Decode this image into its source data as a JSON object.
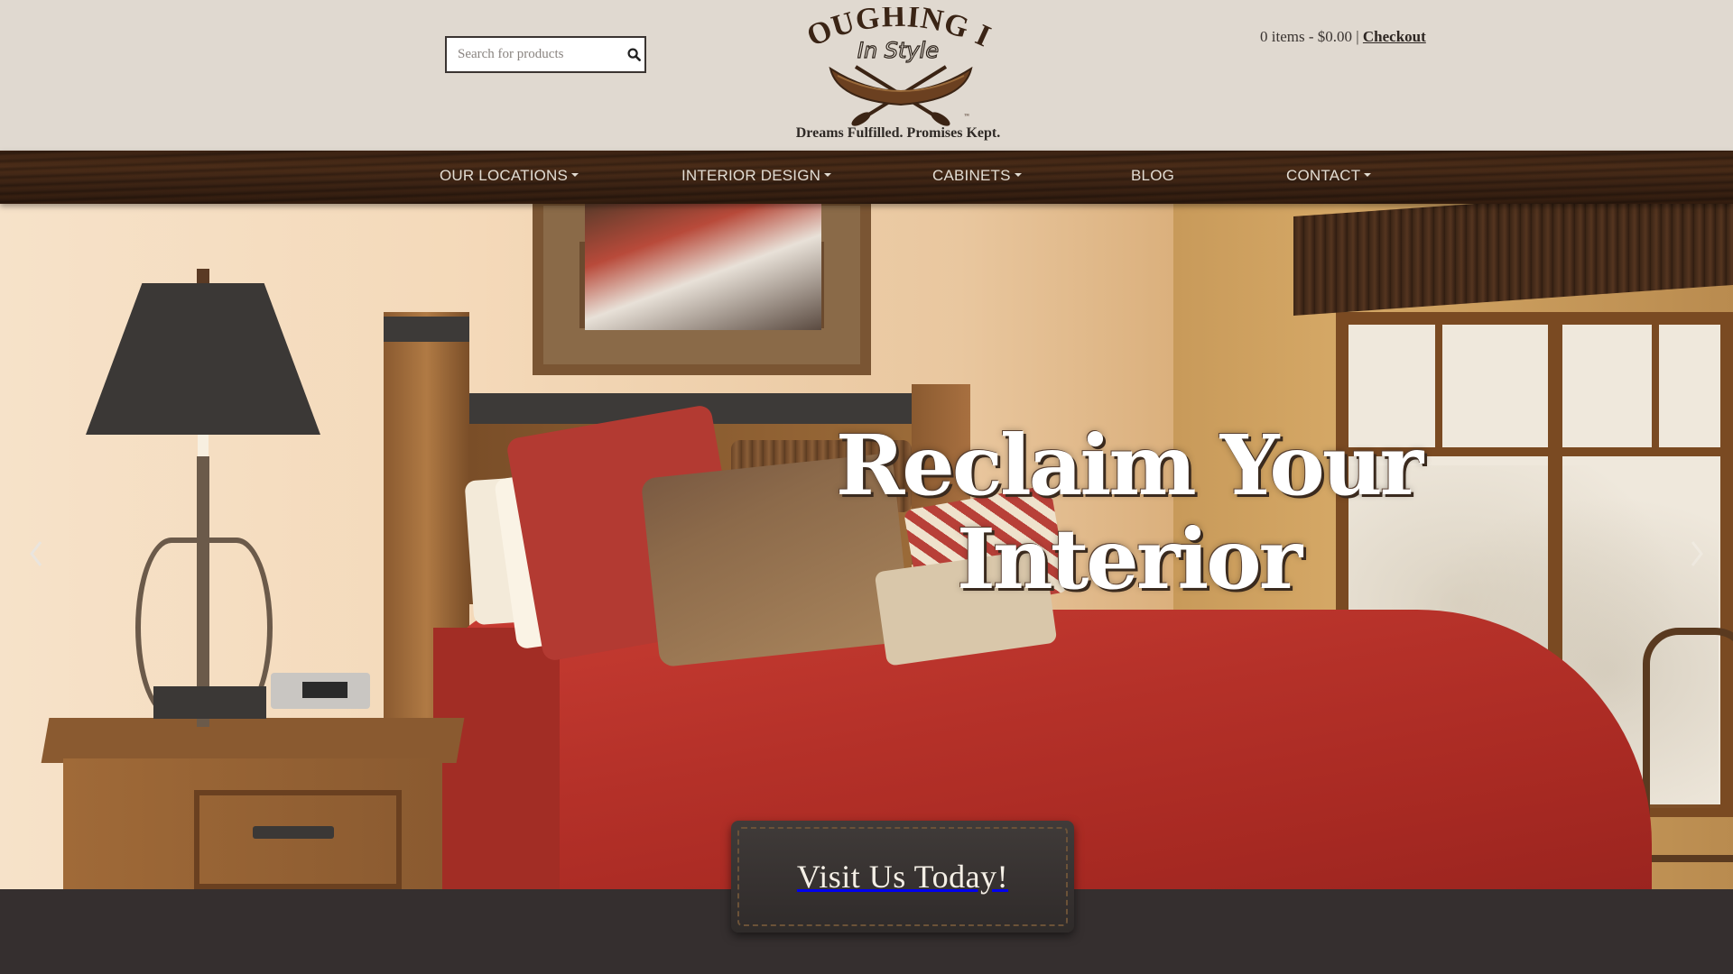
{
  "header": {
    "search": {
      "placeholder": "Search for products",
      "value": "",
      "button_icon": "search-icon"
    },
    "logo": {
      "line1": "ROUGHING IT",
      "line2": "In Style",
      "trademark": "™",
      "tagline": "Dreams Fulfilled. Promises Kept."
    },
    "cart": {
      "summary": "0 items - $0.00",
      "separator": "|",
      "checkout_label": "Checkout"
    }
  },
  "nav": {
    "items": [
      {
        "label": "OUR LOCATIONS",
        "has_dropdown": true
      },
      {
        "label": "INTERIOR DESIGN",
        "has_dropdown": true
      },
      {
        "label": "CABINETS",
        "has_dropdown": true
      },
      {
        "label": "BLOG",
        "has_dropdown": false
      },
      {
        "label": "CONTACT",
        "has_dropdown": true
      }
    ]
  },
  "hero": {
    "title_line1": "Reclaim Your",
    "title_line2": "Interior",
    "prev_icon": "chevron-left-icon",
    "next_icon": "chevron-right-icon",
    "cta_label": "Visit Us Today!"
  },
  "colors": {
    "header_bg": "#e0d9d0",
    "nav_wood": "#3b2314",
    "nav_text": "#e2dcd2",
    "footer_bg": "#352f2f",
    "cta_bg": "#363130",
    "cta_stitch": "#6b5238"
  }
}
